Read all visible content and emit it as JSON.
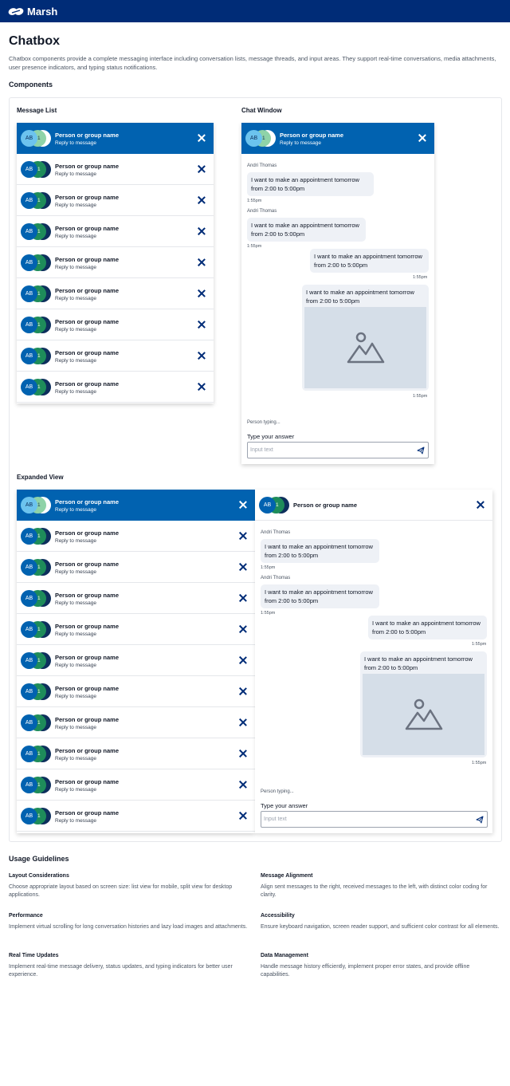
{
  "brand": {
    "name": "Marsh"
  },
  "page": {
    "title": "Chatbox",
    "description": "Chatbox components provide a complete messaging interface including conversation lists, message threads, and input areas. They support real-time conversations, media attachments, user presence indicators, and typing status notifications.",
    "components_heading": "Components"
  },
  "message_list": {
    "label": "Message List",
    "items": [
      {
        "initials": "AB",
        "name": "Person or group name",
        "sub": "Reply to message"
      },
      {
        "initials": "AB",
        "name": "Person or group name",
        "sub": "Reply to message"
      },
      {
        "initials": "AB",
        "name": "Person or group name",
        "sub": "Reply to message"
      },
      {
        "initials": "AB",
        "name": "Person or group name",
        "sub": "Reply to message"
      },
      {
        "initials": "AB",
        "name": "Person or group name",
        "sub": "Reply to message"
      },
      {
        "initials": "AB",
        "name": "Person or group name",
        "sub": "Reply to message"
      },
      {
        "initials": "AB",
        "name": "Person or group name",
        "sub": "Reply to message"
      },
      {
        "initials": "AB",
        "name": "Person or group name",
        "sub": "Reply to message"
      },
      {
        "initials": "AB",
        "name": "Person or group name",
        "sub": "Reply to message"
      }
    ]
  },
  "chat_window": {
    "label": "Chat Window",
    "header": {
      "initials": "AB",
      "name": "Person or group name",
      "sub": "Reply to message"
    },
    "messages": [
      {
        "sender": "Andri Thomas",
        "text": "I want to make an appointment tomorrow from 2:00 to 5:00pm",
        "time": "1:55pm"
      },
      {
        "sender": "Andri Thomas",
        "text": "I want to make an appointment tomorrow from 2:00 to 5:00pm",
        "time": "1:55pm"
      },
      {
        "text": "I want to make an appointment tomorrow from 2:00 to 5:00pm",
        "time": "1:55pm"
      },
      {
        "text": "I want to make an appointment tomorrow from 2:00 to 5:00pm",
        "time": "1:55pm"
      }
    ],
    "typing": "Person typing...",
    "answer_label": "Type your answer",
    "input_placeholder": "Input text"
  },
  "expanded_view": {
    "label": "Expanded View",
    "items": [
      {
        "initials": "AB",
        "name": "Person or group name",
        "sub": "Reply to message"
      },
      {
        "initials": "AB",
        "name": "Person or group name",
        "sub": "Reply to message"
      },
      {
        "initials": "AB",
        "name": "Person or group name",
        "sub": "Reply to message"
      },
      {
        "initials": "AB",
        "name": "Person or group name",
        "sub": "Reply to message"
      },
      {
        "initials": "AB",
        "name": "Person or group name",
        "sub": "Reply to message"
      },
      {
        "initials": "AB",
        "name": "Person or group name",
        "sub": "Reply to message"
      },
      {
        "initials": "AB",
        "name": "Person or group name",
        "sub": "Reply to message"
      },
      {
        "initials": "AB",
        "name": "Person or group name",
        "sub": "Reply to message"
      },
      {
        "initials": "AB",
        "name": "Person or group name",
        "sub": "Reply to message"
      },
      {
        "initials": "AB",
        "name": "Person or group name",
        "sub": "Reply to message"
      },
      {
        "initials": "AB",
        "name": "Person or group name",
        "sub": "Reply to message"
      }
    ],
    "header": {
      "initials": "AB",
      "name": "Person or group name"
    },
    "messages": [
      {
        "sender": "Andri Thomas",
        "text": "I want to make an appointment tomorrow from 2:00 to 5:00pm",
        "time": "1:55pm"
      },
      {
        "sender": "Andri Thomas",
        "text": "I want to make an appointment tomorrow from 2:00 to 5:00pm",
        "time": "1:55pm"
      },
      {
        "text": "I want to make an appointment tomorrow from 2:00 to 5:00pm",
        "time": "1:55pm"
      },
      {
        "text": "I want to make an appointment tomorrow from 2:00 to 5:00pm",
        "time": "1:55pm"
      }
    ],
    "typing": "Person typing...",
    "answer_label": "Type your answer",
    "input_placeholder": "Input text"
  },
  "guidelines": {
    "heading": "Usage Guidelines",
    "items": [
      {
        "title": "Layout Considerations",
        "text": "Choose appropriate layout based on screen size: list view for mobile, split view for desktop applications."
      },
      {
        "title": "Message Alignment",
        "text": "Align sent messages to the right, received messages to the left, with distinct color coding for clarity."
      },
      {
        "title": "Performance",
        "text": "Implement virtual scrolling for long conversation histories and lazy load images and attachments."
      },
      {
        "title": "Accessibility",
        "text": "Ensure keyboard navigation, screen reader support, and sufficient color contrast for all elements."
      },
      {
        "title": "Real Time Updates",
        "text": "Implement real-time message delivery, status updates, and typing indicators for better user experience."
      },
      {
        "title": "Data Management",
        "text": "Handle message history efficiently, implement proper error states, and provide offline capabilities."
      }
    ]
  },
  "colors": {
    "brand_navy": "#002c77",
    "active_blue": "#0162b0",
    "bubble": "#eef1f6",
    "image_placeholder": "#d5dee8"
  },
  "icons": {
    "close": "close-icon",
    "send": "send-icon",
    "image": "image-placeholder-icon",
    "logo": "marsh-logo-icon"
  }
}
